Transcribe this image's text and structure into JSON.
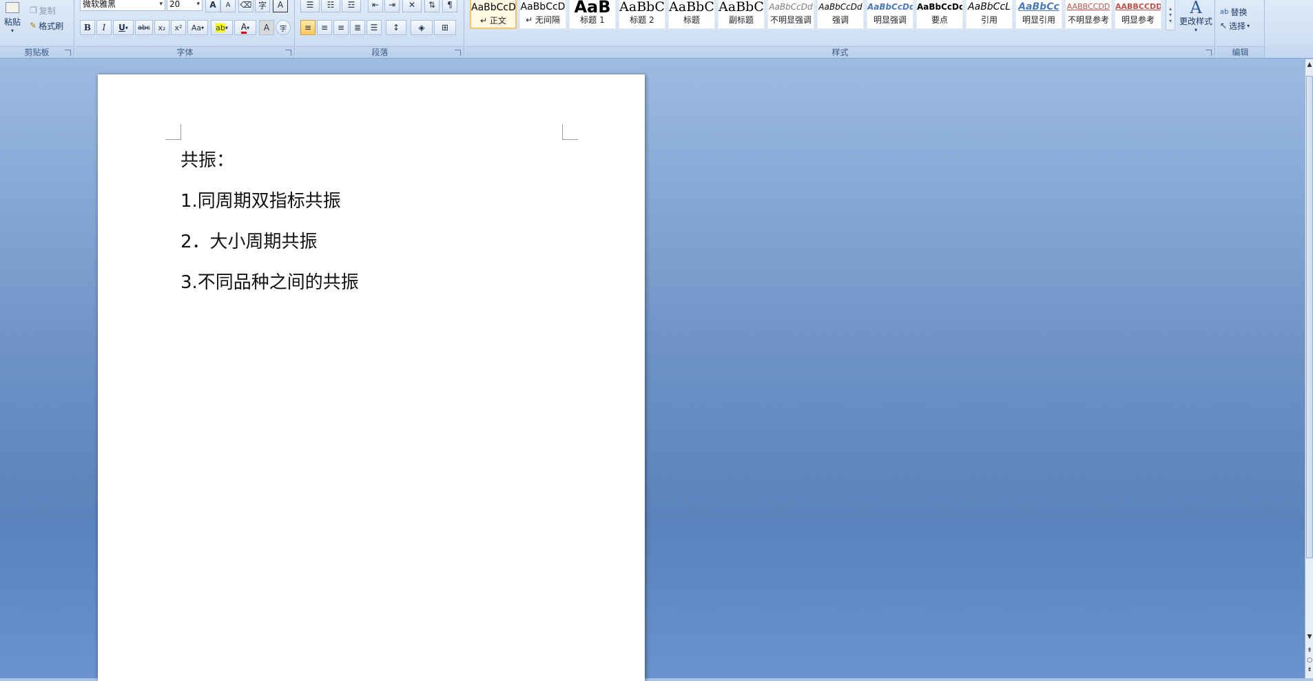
{
  "ribbon": {
    "clipboard": {
      "label": "剪贴板",
      "paste": "粘贴",
      "copy": "复制",
      "format_painter": "格式刷"
    },
    "font": {
      "label": "字体",
      "font_name": "微软雅黑",
      "font_size": "20",
      "grow": "A",
      "shrink": "A",
      "bold": "B",
      "italic": "I",
      "underline": "U",
      "strike": "abc",
      "subscript": "x₂",
      "superscript": "x²",
      "change_case": "Aa",
      "highlight": "ab",
      "font_color": "A",
      "char_shading": "A",
      "enclose": "字"
    },
    "paragraph": {
      "label": "段落"
    },
    "styles": {
      "label": "样式",
      "items": [
        {
          "sample": "AaBbCcD",
          "name": "↵ 正文"
        },
        {
          "sample": "AaBbCcD",
          "name": "↵ 无间隔"
        },
        {
          "sample": "AaB",
          "name": "标题 1"
        },
        {
          "sample": "AaBbC",
          "name": "标题 2"
        },
        {
          "sample": "AaBbC",
          "name": "标题"
        },
        {
          "sample": "AaBbC",
          "name": "副标题"
        },
        {
          "sample": "AaBbCcDd",
          "name": "不明显强调"
        },
        {
          "sample": "AaBbCcDd",
          "name": "强调"
        },
        {
          "sample": "AaBbCcDd",
          "name": "明显强调"
        },
        {
          "sample": "AaBbCcDd",
          "name": "要点"
        },
        {
          "sample": "AaBbCcL",
          "name": "引用"
        },
        {
          "sample": "AaBbCc",
          "name": "明显引用"
        },
        {
          "sample": "AABBCCDD",
          "name": "不明显参考"
        },
        {
          "sample": "AABBCCDD",
          "name": "明显参考"
        }
      ],
      "change_styles": "更改样式"
    },
    "editing": {
      "label": "编辑",
      "replace": "替换",
      "select": "选择"
    }
  },
  "document": {
    "paragraphs": [
      "共振：",
      "1.同周期双指标共振",
      "2．大小周期共振",
      "3.不同品种之间的共振"
    ]
  },
  "colors": {
    "accent_active_style": "#f3c567",
    "ribbon_label": "#3b5a88"
  }
}
